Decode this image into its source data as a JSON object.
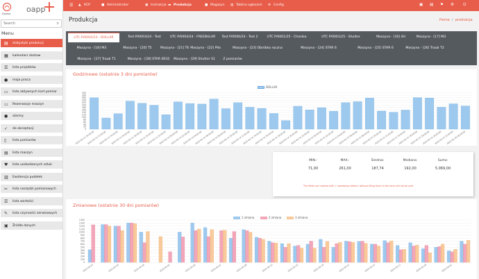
{
  "app": {
    "logo_text": "oapp",
    "logo_sub": "Dreasa"
  },
  "search": {
    "placeholder": "Search"
  },
  "sidebar": {
    "title": "Menu",
    "items": [
      {
        "label": "statystyki produkcji",
        "icon": "chart-icon",
        "glyph": "▤",
        "active": true
      },
      {
        "label": "kalendarz dostaw",
        "icon": "calendar-icon",
        "glyph": "▦"
      },
      {
        "label": "lista projektów",
        "icon": "list-icon",
        "glyph": "☰"
      },
      {
        "label": "moja praca",
        "icon": "user-icon",
        "glyph": "●"
      },
      {
        "label": "lista aktywnych kart pomiar",
        "icon": "card-icon",
        "glyph": "▭"
      },
      {
        "label": "Rezerwacje maszyn",
        "icon": "machine-icon",
        "glyph": "▭"
      },
      {
        "label": "alarmy",
        "icon": "alarm-icon",
        "glyph": "●"
      },
      {
        "label": "do akceptacji",
        "icon": "check-icon",
        "glyph": "✓"
      },
      {
        "label": "lista pomiarów",
        "icon": "measure-icon",
        "glyph": "▯"
      },
      {
        "label": "lista maszyn",
        "icon": "machine-list-icon",
        "glyph": "▤"
      },
      {
        "label": "lista uszkodzonych sztuk",
        "icon": "broken-icon",
        "glyph": "♥"
      },
      {
        "label": "Ewidencja pudełek",
        "icon": "box-icon",
        "glyph": "▥"
      },
      {
        "label": "lista narzędzi pomiarowych",
        "icon": "tool-icon",
        "glyph": "✂"
      },
      {
        "label": "lista wartości",
        "icon": "values-icon",
        "glyph": "☰"
      },
      {
        "label": "lista czynności serwisowych",
        "icon": "wrench-icon",
        "glyph": "✎"
      },
      {
        "label": "Źródła danych",
        "icon": "database-icon",
        "glyph": "▣"
      }
    ]
  },
  "topbar": {
    "nav": [
      {
        "label": "RCP",
        "icon": "clock-icon"
      },
      {
        "label": "Administrator",
        "icon": "admin-icon"
      },
      {
        "label": "Instrukcja",
        "icon": "book-icon"
      },
      {
        "label": "Produkcja",
        "icon": "folder-icon",
        "active": true
      },
      {
        "label": "Magazyn",
        "icon": "warehouse-icon"
      },
      {
        "label": "Tablica ogłoszeń",
        "icon": "board-icon"
      },
      {
        "label": "Config",
        "icon": "config-icon"
      }
    ]
  },
  "page": {
    "title": "Produkcja",
    "breadcrumb_home": "Home",
    "breadcrumb_sep": "/",
    "breadcrumb_current": "produkcja"
  },
  "tabs": [
    [
      "UTC P/0002/23 - DOLLAR",
      "Test P/0003/24 - Test",
      "UTC P/0004/24 - FREEBULAR",
      "Test P/0006/24 - Test 2",
      "UTC P/0001/25 - Chanika",
      "UTC P/0001/25 - Shutter",
      "Maszyna - [16] 4H",
      "Maszyna - [17] M3"
    ],
    [
      "Maszyna - [18] M3",
      "Maszyna - [20] T5",
      "Maszyna - [21] T6",
      "Maszyna - [22] Piła",
      "Maszyna - [23] Obróbka ręczna",
      "Maszyna - [24] STAR 6",
      "Maszyna - [25] STAR 6",
      "Maszyna - [26] Traub T2"
    ],
    [
      "Maszyna - [27] Traub T1",
      "Maszyna - [28] STAR SR32",
      "Maszyna - [29] Shutter S1",
      "Z pomiarów"
    ]
  ],
  "colors": {
    "accent": "#e85d4a",
    "bar_blue": "#9ec9ee",
    "bar_pink": "#f3a6b9",
    "bar_orange": "#f8c99a"
  },
  "hourly": {
    "title": "Godzinowe (ostatnie 3 dni pomiarów)",
    "legend": "DOLLAR",
    "yticks": [
      "300",
      "280",
      "260",
      "240",
      "220",
      "200",
      "180",
      "160",
      "140",
      "120",
      "100",
      "80",
      "60",
      "40",
      "20",
      "0"
    ],
    "note": "The fields are marked with + mandatory before, without filling them in the form will not be sent"
  },
  "stats": {
    "labels": [
      "MIN.:",
      "MAX.:",
      "Średnia:",
      "Mediana:",
      "Suma:"
    ],
    "values": [
      "71,00",
      "261,00",
      "187,74",
      "192,00",
      "5.069,00"
    ]
  },
  "daily": {
    "title": "Zmianowe (ostatnie 30 dni pomiarów)",
    "legend": [
      "1 zmiana",
      "2 zmiana",
      "3 zmiana"
    ],
    "yticks": [
      "1400",
      "1300",
      "1200",
      "1100",
      "1000",
      "900",
      "800",
      "700",
      "600",
      "500",
      "400",
      "300",
      "200",
      "100",
      "0"
    ]
  },
  "chart_data": [
    {
      "type": "bar",
      "title": "Godzinowe (ostatnie 3 dni pomiarów)",
      "ylim": [
        0,
        300
      ],
      "series": [
        {
          "name": "DOLLAR",
          "values": [
            261,
            92,
            128,
            232,
            214,
            198,
            120,
            226,
            212,
            208,
            250,
            170,
            220,
            182,
            172,
            130,
            71,
            190,
            160,
            178,
            148,
            220,
            228,
            258,
            150,
            140,
            158,
            262,
            258,
            182,
            210,
            192
          ]
        }
      ],
      "categories": [
        "2025-05-13 10:00:00",
        "2025-05-13 12:00:00",
        "2025-05-13 14:00:00",
        "2025-05-13 16:00:00",
        "2025-05-13 18:00:00",
        "2025-05-13 20:00:00",
        "2025-05-13 22:00:00",
        "2025-05-14 00:00:00",
        "2025-05-14 02:00:00",
        "2025-05-14 04:00:00",
        "2025-05-14 06:00:00",
        "2025-05-14 08:00:00",
        "2025-05-14 10:00:00",
        "2025-05-14 12:00:00",
        "2025-05-14 14:00:00",
        "2025-05-14 16:00:00",
        "2025-05-14 18:00:00",
        "2025-05-14 20:00:00",
        "2025-05-14 22:00:00",
        "2025-05-15 00:00:00",
        "2025-05-15 02:00:00",
        "2025-05-15 04:00:00",
        "2025-05-15 06:00:00",
        "2025-05-15 08:00:00",
        "2025-05-15 10:00:00",
        "2025-05-15 12:00:00",
        "2025-05-15 14:00:00",
        "2025-05-15 16:00:00",
        "2025-05-15 18:00:00",
        "2025-05-15 20:00:00",
        "2025-05-15 22:00:00",
        "2025-05-16 00:00:00"
      ],
      "grid": true,
      "legend": "top-center"
    },
    {
      "type": "bar",
      "title": "Zmianowe (ostatnie 30 dni pomiarów)",
      "ylim": [
        0,
        1400
      ],
      "categories": [
        "2025-04-23",
        "2025-04-24",
        "2025-04-25",
        "2025-04-28",
        "2025-04-29",
        "2025-04-30",
        "2025-05-01",
        "2025-05-02",
        "2025-05-05",
        "2025-05-06",
        "2025-05-07",
        "2025-05-08",
        "2025-05-09",
        "2025-05-12",
        "2025-05-13",
        "2025-05-14",
        "2025-05-15",
        "2025-05-16",
        "2025-05-19",
        "2025-05-20",
        "2025-05-21",
        "2025-05-22",
        "2025-05-23",
        "2025-05-26",
        "2025-05-27",
        "2025-05-28",
        "2025-05-29",
        "2025-05-30",
        "2025-06-02",
        "2025-06-03"
      ],
      "series": [
        {
          "name": "1 zmiana",
          "values": [
            420,
            1250,
            1200,
            1300,
            1000,
            0,
            0,
            1000,
            1300,
            1150,
            0,
            800,
            1080,
            830,
            700,
            620,
            540,
            600,
            760,
            500,
            700,
            690,
            600,
            720,
            560,
            650,
            450,
            500,
            380,
            700
          ]
        },
        {
          "name": "2 zmiana",
          "values": [
            1240,
            1250,
            1200,
            1300,
            650,
            0,
            350,
            840,
            1050,
            850,
            1050,
            1020,
            1050,
            800,
            650,
            500,
            560,
            700,
            500,
            620,
            680,
            700,
            600,
            650,
            420,
            540,
            560,
            520,
            350,
            600
          ]
        },
        {
          "name": "3 zmiana",
          "values": [
            0,
            1200,
            1050,
            1280,
            1020,
            850,
            0,
            0,
            1100,
            1080,
            1060,
            0,
            990,
            760,
            640,
            620,
            470,
            470,
            690,
            660,
            660,
            630,
            540,
            710,
            430,
            570,
            320,
            600,
            430,
            730
          ]
        }
      ],
      "legend": "top-center",
      "grid": true
    }
  ]
}
